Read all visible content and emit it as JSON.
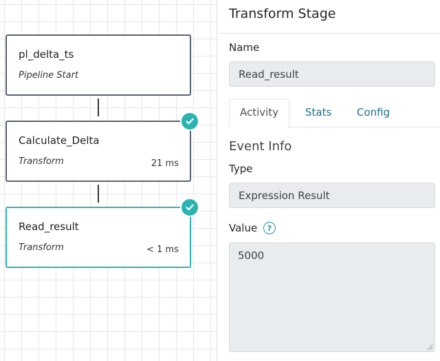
{
  "pipeline": {
    "nodes": [
      {
        "title": "pl_delta_ts",
        "subtitle": "Pipeline Start",
        "time": "",
        "status": "none",
        "selected": false
      },
      {
        "title": "Calculate_Delta",
        "subtitle": "Transform",
        "time": "21 ms",
        "status": "success",
        "selected": false
      },
      {
        "title": "Read_result",
        "subtitle": "Transform",
        "time": "< 1 ms",
        "status": "success",
        "selected": true
      }
    ]
  },
  "panel": {
    "title": "Transform Stage",
    "name_label": "Name",
    "name_value": "Read_result",
    "tabs": [
      {
        "label": "Activity",
        "active": true
      },
      {
        "label": "Stats",
        "active": false
      },
      {
        "label": "Config",
        "active": false
      }
    ],
    "event_info_heading": "Event Info",
    "type_label": "Type",
    "type_value": "Expression Result",
    "value_label": "Value",
    "help_glyph": "?",
    "value_content": "5000"
  },
  "colors": {
    "accent": "#2bb3b1",
    "node_border": "#566271",
    "link": "#1b6d8c",
    "field_bg": "#e9ecef"
  },
  "icons": {
    "status": "check-circle-icon",
    "help": "question-circle-icon"
  }
}
